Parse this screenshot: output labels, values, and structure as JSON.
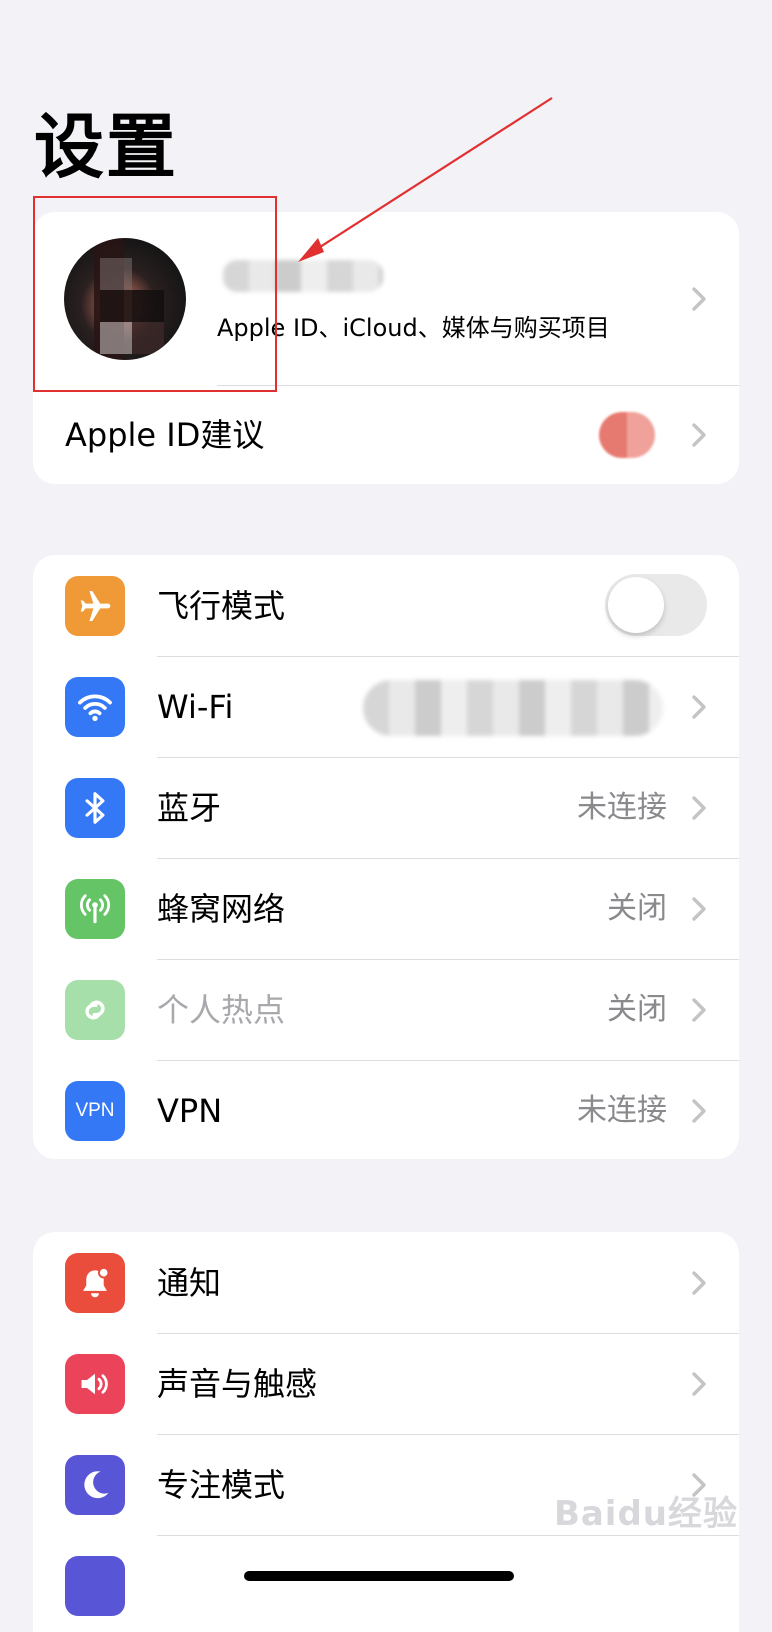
{
  "page": {
    "title": "设置"
  },
  "account": {
    "subtitle": "Apple ID、iCloud、媒体与购买项目",
    "suggestion_label": "Apple ID建议"
  },
  "connectivity": {
    "items": [
      {
        "label": "飞行模式",
        "icon": "airplane-icon",
        "color": "#f09a37",
        "toggle": "off"
      },
      {
        "label": "Wi-Fi",
        "icon": "wifi-icon",
        "color": "#3478f6",
        "value": ""
      },
      {
        "label": "蓝牙",
        "icon": "bluetooth-icon",
        "color": "#3478f6",
        "value": "未连接"
      },
      {
        "label": "蜂窝网络",
        "icon": "cellular-icon",
        "color": "#65c466",
        "value": "关闭"
      },
      {
        "label": "个人热点",
        "icon": "hotspot-icon",
        "color": "#a6dfaa",
        "value": "关闭",
        "disabled": true
      },
      {
        "label": "VPN",
        "icon": "vpn-icon",
        "color": "#3478f6",
        "value": "未连接",
        "icon_text": "VPN"
      }
    ]
  },
  "system": {
    "items": [
      {
        "label": "通知",
        "icon": "bell-icon",
        "color": "#eb4d3d"
      },
      {
        "label": "声音与触感",
        "icon": "speaker-icon",
        "color": "#eb445a"
      },
      {
        "label": "专注模式",
        "icon": "moon-icon",
        "color": "#5856d6"
      }
    ]
  },
  "watermark": "Baidu经验",
  "colors": {
    "background": "#f2f2f7",
    "annotation": "#e03030"
  }
}
